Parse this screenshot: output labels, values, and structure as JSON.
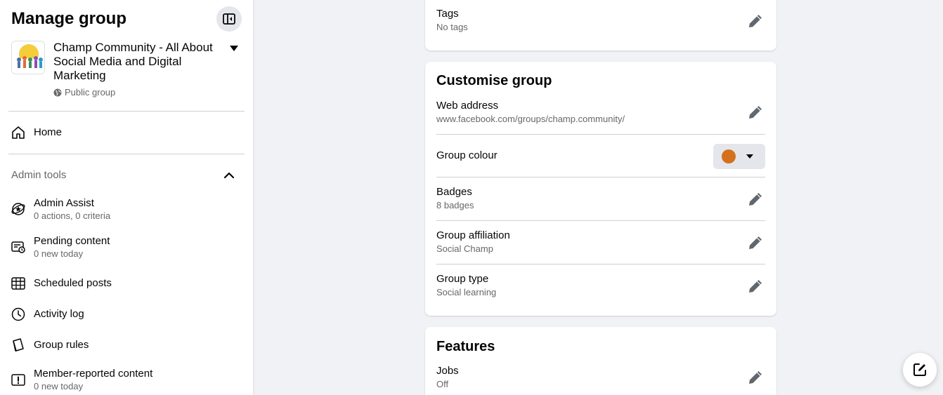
{
  "sidebar": {
    "title": "Manage group",
    "collapse_icon": "sidebar-collapse-icon",
    "group": {
      "name": "Champ Community - All About Social Media and Digital Marketing",
      "privacy": "Public group"
    },
    "home_label": "Home",
    "admin_tools": {
      "title": "Admin tools",
      "items": [
        {
          "label": "Admin Assist",
          "sub": "0 actions, 0 criteria",
          "icon": "admin-assist-icon"
        },
        {
          "label": "Pending content",
          "sub": "0 new today",
          "icon": "pending-content-icon"
        },
        {
          "label": "Scheduled posts",
          "sub": "",
          "icon": "calendar-icon"
        },
        {
          "label": "Activity log",
          "sub": "",
          "icon": "clock-icon"
        },
        {
          "label": "Group rules",
          "sub": "",
          "icon": "rules-book-icon"
        },
        {
          "label": "Member-reported content",
          "sub": "0 new today",
          "icon": "report-icon"
        }
      ]
    }
  },
  "tags_card": {
    "label": "Tags",
    "value": "No tags"
  },
  "customise_card": {
    "title": "Customise group",
    "rows": [
      {
        "label": "Web address",
        "value": "www.facebook.com/groups/champ.community/"
      },
      {
        "label": "Group colour",
        "value": ""
      },
      {
        "label": "Badges",
        "value": "8 badges"
      },
      {
        "label": "Group affiliation",
        "value": "Social Champ"
      },
      {
        "label": "Group type",
        "value": "Social learning"
      }
    ],
    "group_colour": "#d4711c"
  },
  "features_card": {
    "title": "Features",
    "rows": [
      {
        "label": "Jobs",
        "value": "Off"
      }
    ]
  },
  "colors": {
    "icon_gray": "#606770",
    "accent": "#1877f2"
  }
}
